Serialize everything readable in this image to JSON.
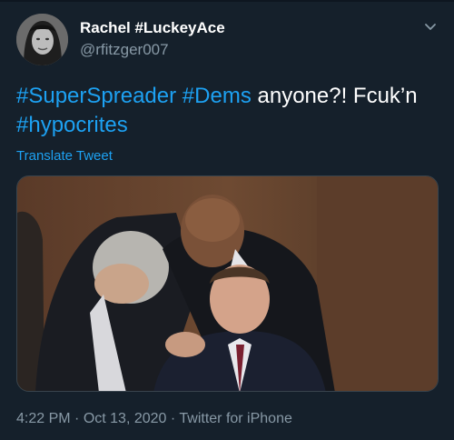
{
  "user": {
    "display_name": "Rachel #LuckeyAce",
    "handle": "@rfitzger007",
    "avatar_icon": "profile-photo"
  },
  "menu_icon": "chevron-down-icon",
  "tweet": {
    "segments": [
      {
        "text": "#SuperSpreader",
        "hashtag": true
      },
      {
        "text": " ",
        "hashtag": false
      },
      {
        "text": "#Dems",
        "hashtag": true
      },
      {
        "text": " anyone?! Fcuk’n ",
        "hashtag": false
      },
      {
        "text": "#hypocrites",
        "hashtag": true
      }
    ],
    "translate_label": "Translate Tweet"
  },
  "meta": {
    "time": "4:22 PM",
    "sep1": " · ",
    "date": "Oct 13, 2020",
    "sep2": " · ",
    "source": "Twitter for iPhone"
  },
  "colors": {
    "background": "#15202b",
    "link": "#1da1f2",
    "secondary_text": "#8899a6"
  }
}
